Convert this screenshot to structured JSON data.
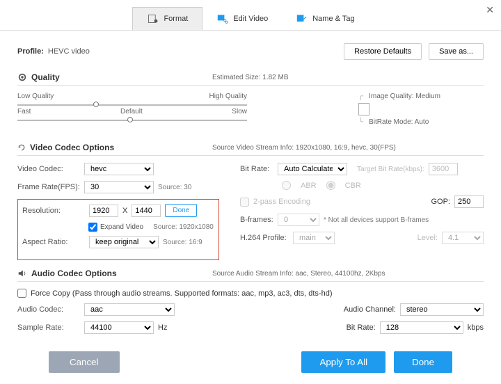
{
  "window": {
    "close": "✕"
  },
  "tabs": {
    "format": "Format",
    "editVideo": "Edit Video",
    "nameTag": "Name & Tag"
  },
  "profile": {
    "label": "Profile:",
    "value": "HEVC video",
    "restore": "Restore Defaults",
    "saveAs": "Save as..."
  },
  "quality": {
    "title": "Quality",
    "estimated": "Estimated Size: 1.82 MB",
    "lowQuality": "Low Quality",
    "highQuality": "High Quality",
    "fast": "Fast",
    "default": "Default",
    "slow": "Slow",
    "imgQuality": "Image Quality: Medium",
    "bitrateMode": "BitRate Mode: Auto"
  },
  "video": {
    "title": "Video Codec Options",
    "streamInfo": "Source Video Stream Info: 1920x1080, 16:9, hevc, 30(FPS)",
    "codecLabel": "Video Codec:",
    "codec": "hevc",
    "fpsLabel": "Frame Rate(FPS):",
    "fps": "30",
    "fpsSource": "Source: 30",
    "resLabel": "Resolution:",
    "resW": "1920",
    "resX": "X",
    "resH": "1440",
    "done": "Done",
    "expand": "Expand Video",
    "resSource": "Source: 1920x1080",
    "arLabel": "Aspect Ratio:",
    "ar": "keep original",
    "arSource": "Source: 16:9",
    "bitrateLabel": "Bit Rate:",
    "bitrate": "Auto Calculate",
    "targetLabel": "Target Bit Rate(kbps):",
    "target": "3600",
    "abr": "ABR",
    "cbr": "CBR",
    "twopass": "2-pass Encoding",
    "gopLabel": "GOP:",
    "gop": "250",
    "bframesLabel": "B-frames:",
    "bframes": "0",
    "bframesNote": "* Not all devices support B-frames",
    "profileLabel": "H.264 Profile:",
    "profile": "main",
    "levelLabel": "Level:",
    "level": "4.1"
  },
  "audio": {
    "title": "Audio Codec Options",
    "streamInfo": "Source Audio Stream Info: aac, Stereo, 44100hz, 2Kbps",
    "forceCopy": "Force Copy (Pass through audio streams. Supported formats: aac, mp3, ac3, dts, dts-hd)",
    "codecLabel": "Audio Codec:",
    "codec": "aac",
    "channelLabel": "Audio Channel:",
    "channel": "stereo",
    "sampleLabel": "Sample Rate:",
    "sample": "44100",
    "hz": "Hz",
    "bitrateLabel": "Bit Rate:",
    "bitrate": "128",
    "kbps": "kbps"
  },
  "footer": {
    "cancel": "Cancel",
    "applyAll": "Apply To All",
    "done": "Done"
  }
}
